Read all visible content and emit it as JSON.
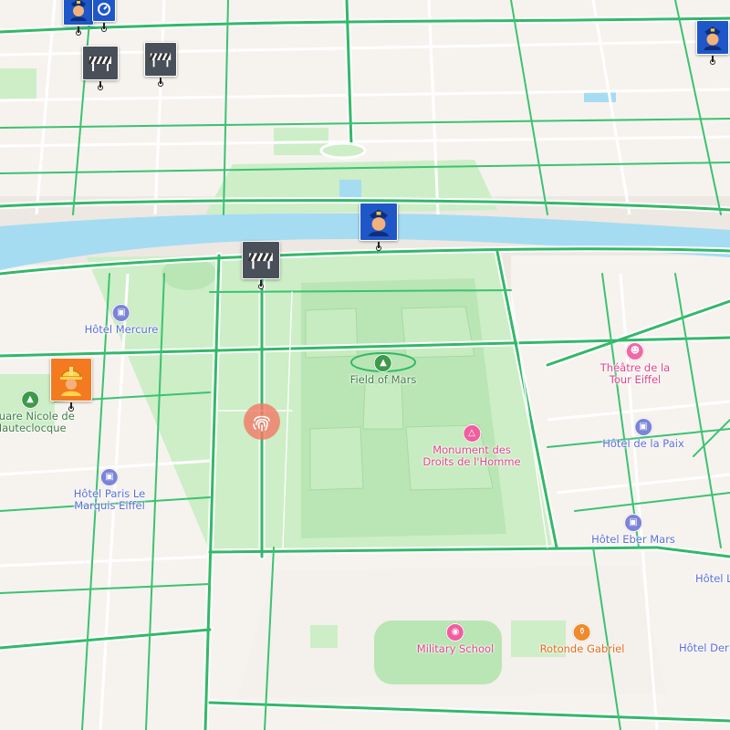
{
  "map": {
    "colors": {
      "land": "#ede8e2",
      "block": "#f6f3ef",
      "park": "#cdeec7",
      "park_inner": "#b9e6b4",
      "water": "#a5dcf2",
      "road_casing": "#ffffff",
      "road_green": "#33b869",
      "label_blue": "#5c6fd6",
      "label_green": "#3f7d46",
      "label_pink": "#e0458a",
      "label_orange": "#e36b17"
    },
    "places": [
      {
        "id": "hotel-mercure",
        "label": "Hôtel Mercure",
        "category": "hotel",
        "icon": "bed-icon",
        "color": "#7b84d8"
      },
      {
        "id": "field-of-mars",
        "label": "Field of Mars",
        "category": "park",
        "icon": "tree-icon",
        "color": "#3e9a4a"
      },
      {
        "id": "theatre",
        "label": "Théâtre de la\nTour Eiffel",
        "category": "theatre",
        "icon": "theatre-icon",
        "color": "#f06aa6"
      },
      {
        "id": "square-nicole",
        "label": "Square Nicole de\nHauteclocque",
        "category": "park",
        "icon": "tree-icon",
        "color": "#3e9a4a"
      },
      {
        "id": "hotel-de-la-paix",
        "label": "Hôtel de la Paix",
        "category": "hotel",
        "icon": "bed-icon",
        "color": "#7b84d8"
      },
      {
        "id": "monument",
        "label": "Monument des\nDroits de l'Homme",
        "category": "monument",
        "icon": "monument-icon",
        "color": "#ef5fa0"
      },
      {
        "id": "hotel-paris-le-marquis",
        "label": "Hôtel Paris Le\nMarquis Eiffel",
        "category": "hotel",
        "icon": "bed-icon",
        "color": "#7b84d8"
      },
      {
        "id": "hotel-eber-mars",
        "label": "Hôtel Eber Mars",
        "category": "hotel",
        "icon": "bed-icon",
        "color": "#7b84d8"
      },
      {
        "id": "hotel-l-partial",
        "label": "Hôtel L",
        "category": "hotel",
        "icon": "bed-icon",
        "color": "#7b84d8"
      },
      {
        "id": "military-school",
        "label": "Military School",
        "category": "landmark",
        "icon": "camera-icon",
        "color": "#ef5fa0"
      },
      {
        "id": "rotonde-gabriel",
        "label": "Rotonde Gabriel",
        "category": "restaurant",
        "icon": "fork-knife-icon",
        "color": "#f08a2c"
      },
      {
        "id": "hotel-der-partial",
        "label": "Hôtel Der",
        "category": "hotel",
        "icon": "bed-icon",
        "color": "#7b84d8"
      }
    ],
    "markers": [
      {
        "id": "police-1",
        "type": "police",
        "icon": "police-officer-icon",
        "color": "#1f57c8"
      },
      {
        "id": "police-2",
        "type": "police",
        "icon": "police-officer-icon",
        "color": "#1f57c8"
      },
      {
        "id": "police-3",
        "type": "police",
        "icon": "police-officer-icon",
        "color": "#1f57c8"
      },
      {
        "id": "police-4",
        "type": "police",
        "icon": "police-officer-icon",
        "color": "#1f57c8"
      },
      {
        "id": "police-5",
        "type": "police",
        "icon": "police-officer-icon",
        "color": "#1f57c8"
      },
      {
        "id": "roadblock-1",
        "type": "roadblock",
        "icon": "road-barrier-icon",
        "color": "#4a5059"
      },
      {
        "id": "roadblock-2",
        "type": "roadblock",
        "icon": "road-barrier-icon",
        "color": "#4a5059"
      },
      {
        "id": "roadblock-3",
        "type": "roadblock",
        "icon": "road-barrier-icon",
        "color": "#4a5059"
      },
      {
        "id": "construction-1",
        "type": "construction",
        "icon": "hard-hat-worker-icon",
        "color": "#f47a20"
      },
      {
        "id": "fingerprint-1",
        "type": "incident",
        "icon": "fingerprint-icon",
        "color": "#f27864"
      }
    ]
  }
}
